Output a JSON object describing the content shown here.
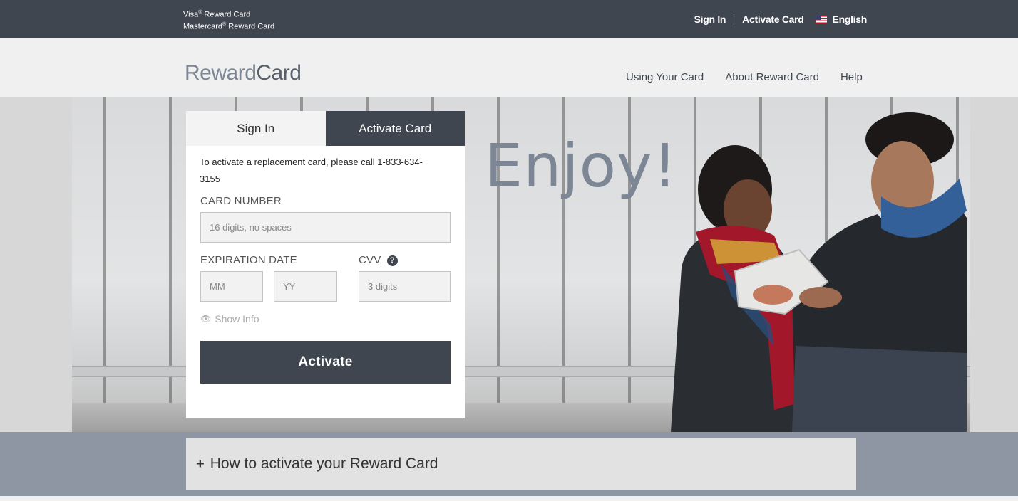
{
  "topbar": {
    "brand_line1": "Visa",
    "brand_line1_suffix": " Reward Card",
    "brand_line2": "Mastercard",
    "brand_line2_suffix": " Reward Card",
    "reg_mark": "®",
    "sign_in": "Sign In",
    "activate_card": "Activate Card",
    "language": "English",
    "language_icon": "us-flag-icon"
  },
  "header": {
    "logo_part1": "Reward",
    "logo_part2": "Card",
    "nav": [
      "Using Your Card",
      "About Reward Card",
      "Help"
    ]
  },
  "hero": {
    "headline": "Enjoy!"
  },
  "form": {
    "tabs": [
      "Sign In",
      "Activate Card"
    ],
    "active_tab": "Activate Card",
    "note": "To activate a replacement card, please call 1-833-634-3155",
    "card_number_label": "CARD NUMBER",
    "card_number_placeholder": "16 digits, no spaces",
    "expiration_label": "EXPIRATION DATE",
    "month_placeholder": "MM",
    "year_placeholder": "YY",
    "cvv_label": "CVV",
    "cvv_help_glyph": "?",
    "cvv_placeholder": "3 digits",
    "show_info": "Show Info",
    "show_info_icon": "eye-icon",
    "submit": "Activate"
  },
  "accordion": {
    "icon": "+",
    "title": "How to activate your Reward Card"
  },
  "colors": {
    "dark": "#3f4650",
    "logo_grey": "#7c8694",
    "band": "#8d96a2"
  }
}
